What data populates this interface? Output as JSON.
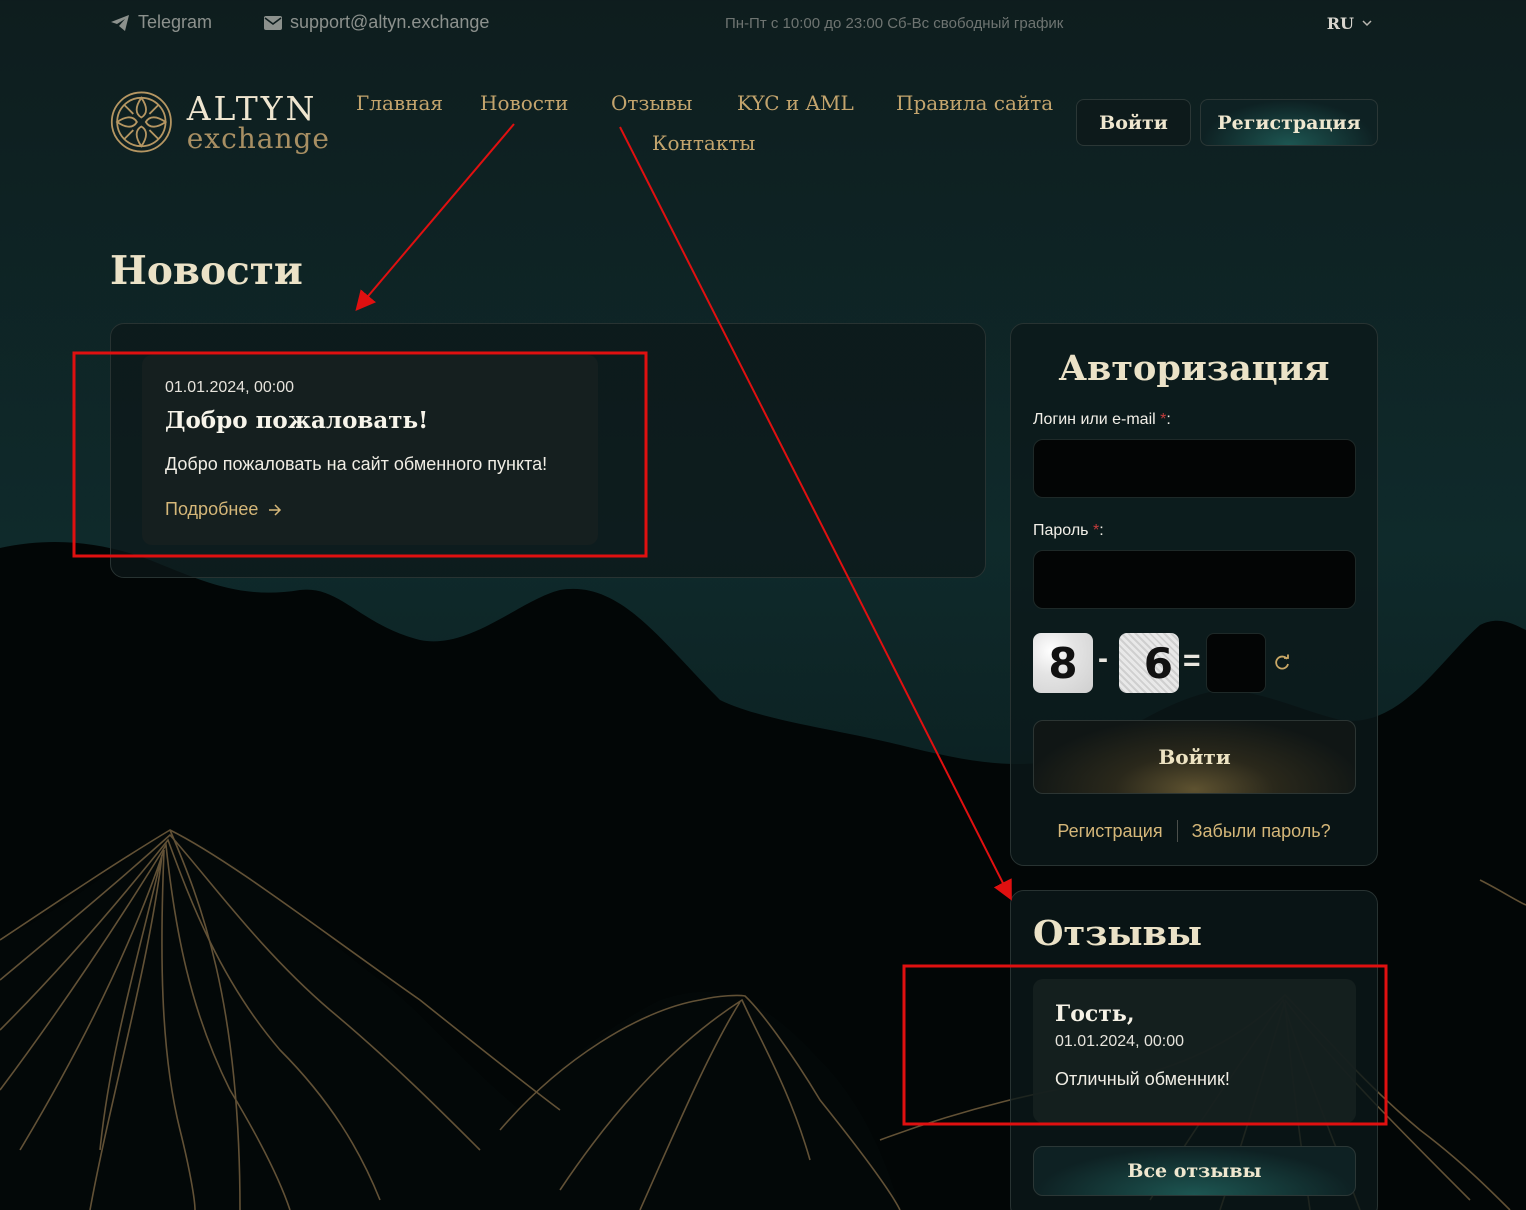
{
  "topbar": {
    "telegram": "Telegram",
    "email": "support@altyn.exchange",
    "hours": "Пн-Пт с 10:00 до 23:00 Сб-Вс свободный график",
    "lang": "RU"
  },
  "logo": {
    "line1": "ALTYN",
    "line2": "exchange"
  },
  "nav": {
    "home": "Главная",
    "news": "Новости",
    "reviews": "Отзывы",
    "kyc": "KYC и AML",
    "rules": "Правила сайта",
    "contacts": "Контакты"
  },
  "header_buttons": {
    "login": "Войти",
    "register": "Регистрация"
  },
  "page_title": "Новости",
  "news": [
    {
      "date": "01.01.2024, 00:00",
      "title": "Добро пожаловать!",
      "text": "Добро пожаловать на сайт обменного пункта!",
      "more": "Подробнее"
    }
  ],
  "auth": {
    "title": "Авторизация",
    "login_label": "Логин или e-mail",
    "password_label": "Пароль",
    "required_mark": "*",
    "label_suffix": ":",
    "captcha": {
      "a": "8",
      "op": "-",
      "b": "6",
      "eq": "="
    },
    "submit": "Войти",
    "register_link": "Регистрация",
    "forgot_link": "Забыли пароль?"
  },
  "reviews": {
    "title": "Отзывы",
    "items": [
      {
        "name": "Гость,",
        "date": "01.01.2024, 00:00",
        "text": "Отличный обменник!"
      }
    ],
    "all_button": "Все отзывы"
  },
  "colors": {
    "gold_accent": "#c3a46d",
    "link_gold": "#d5b779",
    "annotation_red": "#e01010",
    "bg_dark": "#0f2a2b"
  }
}
